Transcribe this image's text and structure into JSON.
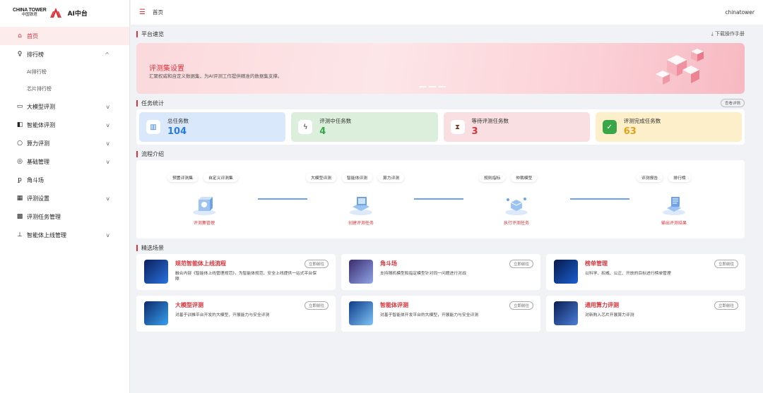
{
  "brand": {
    "en": "CHINA TOWER",
    "cn": "中国铁塔",
    "app": "AI中台"
  },
  "sidebar": {
    "items": [
      {
        "icon": "home-icon",
        "glyph": "⌂",
        "label": "首页",
        "active": true,
        "chevron": ""
      },
      {
        "icon": "trophy-icon",
        "glyph": "♀",
        "label": "排行榜",
        "chevron": "^"
      },
      {
        "label": "AI排行榜",
        "sub": true
      },
      {
        "label": "芯片排行榜",
        "sub": true
      },
      {
        "icon": "chat-icon",
        "glyph": "▭",
        "label": "大模型评测",
        "chevron": "v"
      },
      {
        "icon": "agent-icon",
        "glyph": "◧",
        "label": "智能体评测",
        "chevron": "v"
      },
      {
        "icon": "compute-icon",
        "glyph": "○",
        "label": "算力评测",
        "chevron": "v"
      },
      {
        "icon": "settings-icon",
        "glyph": "◎",
        "label": "基础管理",
        "chevron": "v"
      },
      {
        "icon": "arena-icon",
        "glyph": "ꝑ",
        "label": "角斗场",
        "chevron": ""
      },
      {
        "icon": "grid-icon",
        "glyph": "▦",
        "label": "评测设置",
        "chevron": "v"
      },
      {
        "icon": "task-icon",
        "glyph": "▩",
        "label": "评测任务管理",
        "chevron": ""
      },
      {
        "icon": "upload-icon",
        "glyph": "⊥",
        "label": "智能体上线管理",
        "chevron": "v"
      }
    ]
  },
  "topbar": {
    "crumb": "首页",
    "user": "chinatower"
  },
  "overview": {
    "title": "平台速览",
    "download": "⤓ 下载操作手册",
    "banner_title": "评测集设置",
    "banner_desc": "汇聚权威和自定义数据集，为AI评测工作提供精准的数据集支撑。"
  },
  "stats": {
    "title": "任务统计",
    "view": "查看详情",
    "items": [
      {
        "icon": "chart-icon",
        "glyph": "▥",
        "label": "总任务数",
        "value": "104"
      },
      {
        "icon": "bolt-icon",
        "glyph": "ϟ",
        "label": "评测中任务数",
        "value": "4"
      },
      {
        "icon": "hourglass-icon",
        "glyph": "⧗",
        "label": "等待评测任务数",
        "value": "3"
      },
      {
        "icon": "check-icon",
        "glyph": "✓",
        "label": "评测完成任务数",
        "value": "63"
      }
    ]
  },
  "flow": {
    "title": "流程介绍",
    "groups": [
      {
        "tags": [
          "预置评测集",
          "自定义评测集"
        ],
        "label": "评测集管理"
      },
      {
        "tags": [
          "大模型评测",
          "智能体评测",
          "算力评测"
        ],
        "label": "创建评测任务"
      },
      {
        "tags": [
          "规则指标",
          "仲裁模型"
        ],
        "label": "执行评测任务"
      },
      {
        "tags": [
          "评测报告",
          "排行榜"
        ],
        "label": "输出评测结果"
      }
    ]
  },
  "scenes": {
    "title": "精选场景",
    "go": "立即前往",
    "cards": [
      {
        "title": "规范智能体上线流程",
        "desc": "融合内部《智能体上线管理规范》，为智能体规范、安全上线提供一站式平台保障"
      },
      {
        "title": "角斗场",
        "desc": "支持随机模型和指定模型针对同一问题进行对战"
      },
      {
        "title": "榜单管理",
        "desc": "以科学、权威、公正、开放的目标进行榜单管理"
      },
      {
        "title": "大模型评测",
        "desc": "对基于训推平台开发的大模型，开展能力与安全评测"
      },
      {
        "title": "智能体评测",
        "desc": "对基于智能体开发平台的大模型，开展能力与安全评测"
      },
      {
        "title": "通用算力评测",
        "desc": "对新购入芯片开展算力评测"
      }
    ]
  },
  "colors": {
    "accent": "#d9343c",
    "blue": "#2f7bd9",
    "green": "#3aa64a",
    "orange": "#e0a21a"
  }
}
